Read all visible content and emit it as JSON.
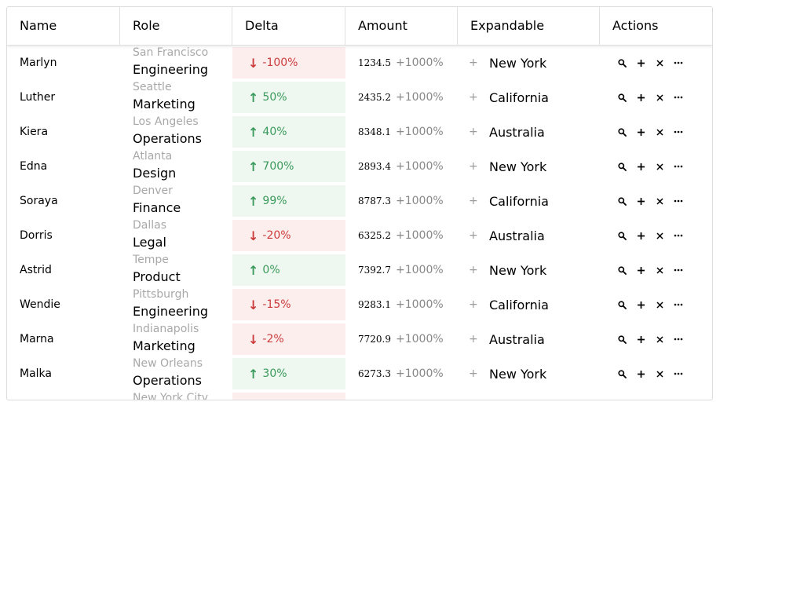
{
  "columns": {
    "name": "Name",
    "role": "Role",
    "delta": "Delta",
    "amount": "Amount",
    "expandable": "Expandable",
    "actions": "Actions"
  },
  "rows": [
    {
      "name": "Marlyn",
      "city": "San Francisco",
      "dept": "Engineering",
      "delta": "-100%",
      "trend": "down",
      "amount": "1234.5",
      "pct": "+1000%",
      "location": "New York"
    },
    {
      "name": "Luther",
      "city": "Seattle",
      "dept": "Marketing",
      "delta": "50%",
      "trend": "up",
      "amount": "2435.2",
      "pct": "+1000%",
      "location": "California"
    },
    {
      "name": "Kiera",
      "city": "Los Angeles",
      "dept": "Operations",
      "delta": "40%",
      "trend": "up",
      "amount": "8348.1",
      "pct": "+1000%",
      "location": "Australia"
    },
    {
      "name": "Edna",
      "city": "Atlanta",
      "dept": "Design",
      "delta": "700%",
      "trend": "up",
      "amount": "2893.4",
      "pct": "+1000%",
      "location": "New York"
    },
    {
      "name": "Soraya",
      "city": "Denver",
      "dept": "Finance",
      "delta": "99%",
      "trend": "up",
      "amount": "8787.3",
      "pct": "+1000%",
      "location": "California"
    },
    {
      "name": "Dorris",
      "city": "Dallas",
      "dept": "Legal",
      "delta": "-20%",
      "trend": "down",
      "amount": "6325.2",
      "pct": "+1000%",
      "location": "Australia"
    },
    {
      "name": "Astrid",
      "city": "Tempe",
      "dept": "Product",
      "delta": "0%",
      "trend": "up",
      "amount": "7392.7",
      "pct": "+1000%",
      "location": "New York"
    },
    {
      "name": "Wendie",
      "city": "Pittsburgh",
      "dept": "Engineering",
      "delta": "-15%",
      "trend": "down",
      "amount": "9283.1",
      "pct": "+1000%",
      "location": "California"
    },
    {
      "name": "Marna",
      "city": "Indianapolis",
      "dept": "Marketing",
      "delta": "-2%",
      "trend": "down",
      "amount": "7720.9",
      "pct": "+1000%",
      "location": "Australia"
    },
    {
      "name": "Malka",
      "city": "New Orleans",
      "dept": "Operations",
      "delta": "30%",
      "trend": "up",
      "amount": "6273.3",
      "pct": "+1000%",
      "location": "New York"
    },
    {
      "name": "",
      "city": "New York City",
      "dept": "",
      "delta": "",
      "trend": "down",
      "amount": "",
      "pct": "",
      "location": ""
    }
  ],
  "icons": {
    "expand": "plus-icon",
    "actions": [
      "search-icon",
      "add-icon",
      "close-icon",
      "more-icon"
    ]
  },
  "colors": {
    "up_text": "#3a9a5b",
    "up_bg": "#eef7f0",
    "down_text": "#cc3b3b",
    "down_bg": "#fdeeee"
  }
}
